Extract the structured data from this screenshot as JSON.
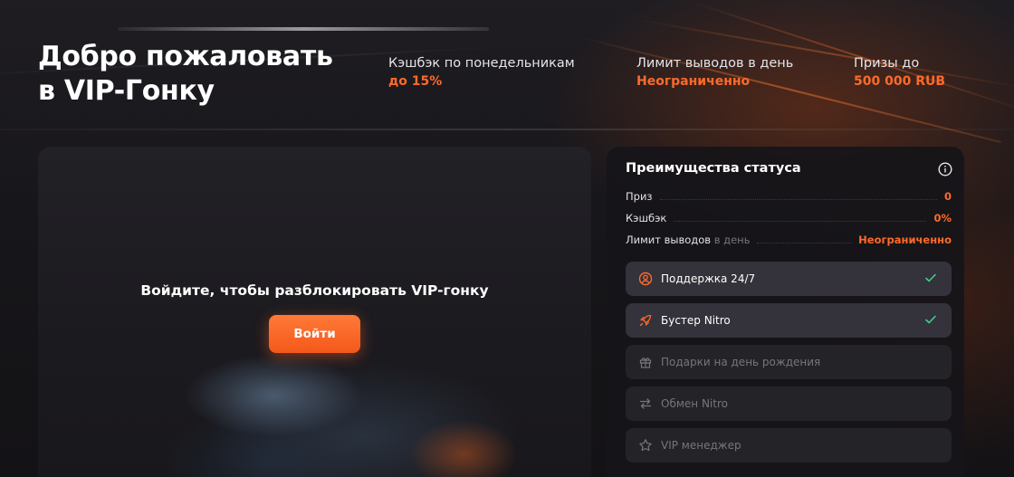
{
  "header": {
    "title_line1": "Добро пожаловать",
    "title_line2": "в VIP-Гонку",
    "stats": [
      {
        "label": "Кэшбэк по понедельникам",
        "value": "до 15%"
      },
      {
        "label": "Лимит выводов в день",
        "value": "Неограниченно"
      },
      {
        "label": "Призы до",
        "value": "500 000 RUB"
      }
    ]
  },
  "locked": {
    "message": "Войдите, чтобы разблокировать VIP-гонку",
    "login_label": "Войти"
  },
  "status": {
    "title": "Преимущества статуса",
    "rows": [
      {
        "label": "Приз",
        "muted": "",
        "value": "0"
      },
      {
        "label": "Кэшбэк",
        "muted": "",
        "value": "0%"
      },
      {
        "label": "Лимит выводов",
        "muted": "в день",
        "value": "Неограниченно"
      }
    ],
    "perks": [
      {
        "label": "Поддержка 24/7",
        "icon": "support-icon",
        "active": true
      },
      {
        "label": "Бустер Nitro",
        "icon": "rocket-icon",
        "active": true
      },
      {
        "label": "Подарки на день рождения",
        "icon": "gift-icon",
        "active": false
      },
      {
        "label": "Обмен Nitro",
        "icon": "exchange-icon",
        "active": false
      },
      {
        "label": "VIP менеджер",
        "icon": "star-icon",
        "active": false
      }
    ]
  },
  "colors": {
    "accent": "#ff6a2a",
    "check": "#3ecf8e",
    "panel": "#161519"
  }
}
